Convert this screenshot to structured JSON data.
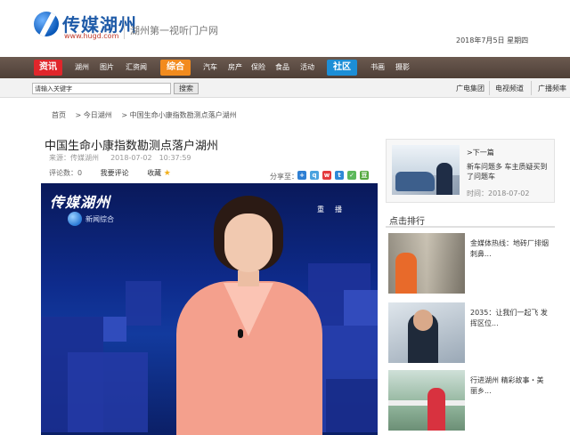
{
  "header": {
    "logo_text": "传媒湖州",
    "logo_url": "www.hugd.com",
    "slogan": "湖州第一视听门户网",
    "date": "2018年7月5日 星期四"
  },
  "nav": {
    "items": [
      {
        "label": "资讯",
        "style": "pill",
        "color": "#e0262b"
      },
      {
        "label": "湖州",
        "style": "text"
      },
      {
        "label": "图片",
        "style": "text"
      },
      {
        "label": "汇资闻",
        "style": "text"
      },
      {
        "label": "综合",
        "style": "pill",
        "color": "#f28b1e"
      },
      {
        "label": "汽车",
        "style": "text"
      },
      {
        "label": "房产",
        "style": "text"
      },
      {
        "label": "保险",
        "style": "text"
      },
      {
        "label": "食品",
        "style": "text"
      },
      {
        "label": "活动",
        "style": "text"
      },
      {
        "label": "社区",
        "style": "pill",
        "color": "#1c8ed6"
      },
      {
        "label": "书画",
        "style": "text"
      },
      {
        "label": "摄影",
        "style": "text"
      }
    ]
  },
  "search": {
    "placeholder": "请输入关键字",
    "button_label": "搜索"
  },
  "top_links": [
    "广电集团",
    "电视频道",
    "广播频率"
  ],
  "breadcrumb": [
    "首页",
    "> 今日湖州",
    "> 中国生命小康指数勘测点落户湖州"
  ],
  "article": {
    "title": "中国生命小康指数勘测点落户湖州",
    "source_label": "来源：传媒湖州",
    "publish_time": "2018-07-02　10:37:59",
    "comment_count": "评论数：0",
    "comment_link": "我要评论",
    "favorite": "收藏",
    "share_label": "分享至："
  },
  "video": {
    "logo": "传媒湖州",
    "channel": "新闻综合",
    "rebroadcast": "重　播"
  },
  "sidebar": {
    "next_label": ">下一篇",
    "next_title": "新车问题多 车主质疑买到了问题车",
    "next_time": "时间：2018-07-02",
    "ranking_title": "点击排行",
    "ranking": [
      {
        "title": "金媒体热线：地砖厂排烟刺鼻..."
      },
      {
        "title": "2035：让我们一起飞 发挥区位..."
      },
      {
        "title": "行进湖州 精彩故事・美丽乡..."
      }
    ]
  },
  "colors": {
    "nav_bg": "#5a4a41",
    "logo_blue": "#1f5ba8",
    "video_bg": "#0e2b8c"
  }
}
